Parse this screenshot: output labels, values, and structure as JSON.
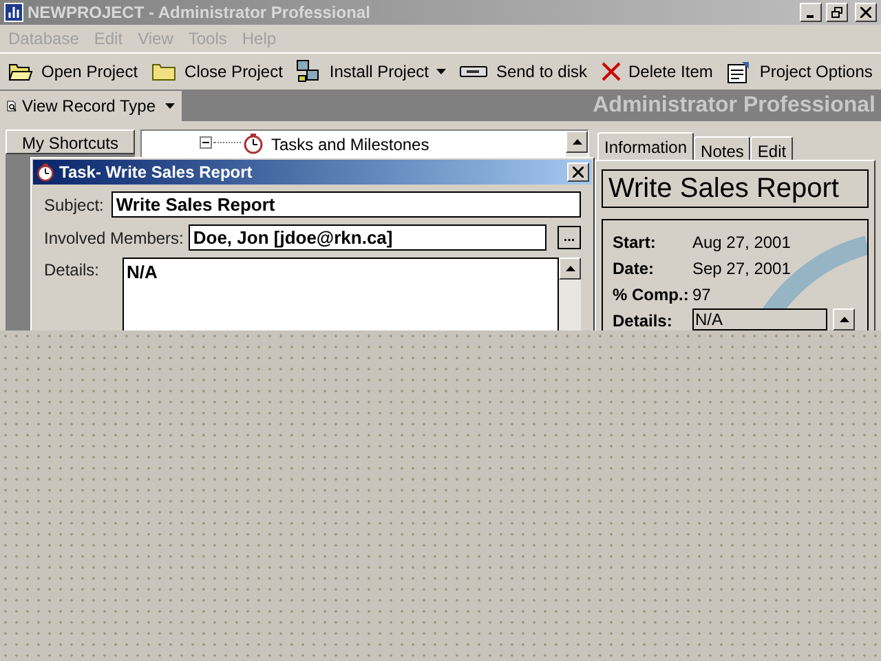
{
  "window": {
    "title": "NEWPROJECT - Administrator Professional"
  },
  "menu": [
    "Database",
    "Edit",
    "View",
    "Tools",
    "Help"
  ],
  "toolbar": [
    {
      "kind": "folder-open",
      "label": "Open Project",
      "dropdown": false
    },
    {
      "kind": "folder",
      "label": "Close Project",
      "dropdown": false
    },
    {
      "kind": "computers",
      "label": "Install Project",
      "dropdown": true
    },
    {
      "kind": "disk",
      "label": "Send to disk",
      "dropdown": false
    },
    {
      "kind": "delete",
      "label": "Delete Item",
      "dropdown": false
    },
    {
      "kind": "options",
      "label": "Project Options",
      "dropdown": false
    }
  ],
  "view_button": {
    "label": "View Record Type"
  },
  "banner": "Administrator Professional",
  "shortcuts": {
    "label": "My Shortcuts"
  },
  "tree": {
    "item": "Tasks and Milestones",
    "expanded": true
  },
  "dialog": {
    "title": "Task- Write Sales Report",
    "fields": [
      {
        "label": "Subject:",
        "value": "Write Sales Report"
      },
      {
        "label": "Involved Members:",
        "value": "Doe, Jon [jdoe@rkn.ca]",
        "browse": "..."
      },
      {
        "label": "Details:",
        "value": "N/A"
      }
    ]
  },
  "tabs": [
    {
      "label": "Information",
      "selected": true
    },
    {
      "label": "Notes",
      "selected": false
    },
    {
      "label": "Edit",
      "selected": false
    }
  ],
  "info": {
    "heading": "Write Sales Report",
    "rows": [
      {
        "label": "Start:",
        "value": "Aug 27, 2001"
      },
      {
        "label": "Date:",
        "value": "Sep 27, 2001"
      },
      {
        "label": "% Comp.:",
        "value": "97"
      }
    ],
    "details_label": "Details:",
    "details_value": "N/A"
  }
}
